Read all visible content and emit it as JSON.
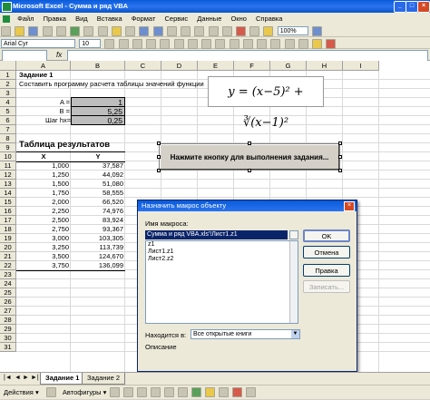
{
  "window": {
    "title": "Microsoft Excel - Сумма и ряд VBA"
  },
  "menu": [
    "Файл",
    "Правка",
    "Вид",
    "Вставка",
    "Формат",
    "Сервис",
    "Данные",
    "Окно",
    "Справка"
  ],
  "toolbar": {
    "zoom": "100%",
    "font": "Arial Cyr",
    "font_size": "10"
  },
  "formula_bar": {
    "fx": "fx",
    "namebox": "",
    "value": ""
  },
  "columns": [
    "A",
    "B",
    "C",
    "D",
    "E",
    "F",
    "G",
    "H",
    "I"
  ],
  "rows": [
    "1",
    "2",
    "3",
    "4",
    "5",
    "6",
    "7",
    "8",
    "9",
    "10",
    "11",
    "12",
    "13",
    "14",
    "15",
    "16",
    "17",
    "18",
    "19",
    "20",
    "21",
    "22",
    "23",
    "24",
    "25",
    "26",
    "27",
    "28",
    "29",
    "30",
    "31"
  ],
  "sheet": {
    "task_title": "Задание 1",
    "task_text": "Составить программу расчета таблицы значений функции",
    "label_a": "A =",
    "label_b": "B =",
    "label_h": "Шаг hx=",
    "value_a": "1",
    "value_b": "5,25",
    "value_h": "0,25",
    "results_title": "Таблица результатов",
    "col_x": "X",
    "col_y": "Y",
    "table": [
      [
        "1,000",
        "37,587"
      ],
      [
        "1,250",
        "44,092"
      ],
      [
        "1,500",
        "51,080"
      ],
      [
        "1,750",
        "58,555"
      ],
      [
        "2,000",
        "66,520"
      ],
      [
        "2,250",
        "74,976"
      ],
      [
        "2,500",
        "83,924"
      ],
      [
        "2,750",
        "93,367"
      ],
      [
        "3,000",
        "103,305"
      ],
      [
        "3,250",
        "113,739"
      ],
      [
        "3,500",
        "124,670"
      ],
      [
        "3,750",
        "136,099"
      ]
    ],
    "formula": "y = (x−5)² + ∛(x−1)²",
    "run_button": "Нажмите кнопку для выполнения задания..."
  },
  "dialog": {
    "title": "Назначить макрос объекту",
    "name_label": "Имя макроса:",
    "macro_name": "Сумма и ряд VBA.xls'!Лист1.z1",
    "macros": [
      "z1",
      "Лист1.z1",
      "Лист2.z2"
    ],
    "buttons": {
      "ok": "OK",
      "cancel": "Отмена",
      "edit": "Правка",
      "record": "Записать..."
    },
    "location_label": "Находится в:",
    "location_value": "Все открытые книги",
    "description_label": "Описание"
  },
  "tabs": [
    "Задание 1",
    "Задание 2"
  ],
  "drawbar": {
    "actions": "Действия",
    "autoshapes": "Автофигуры"
  }
}
